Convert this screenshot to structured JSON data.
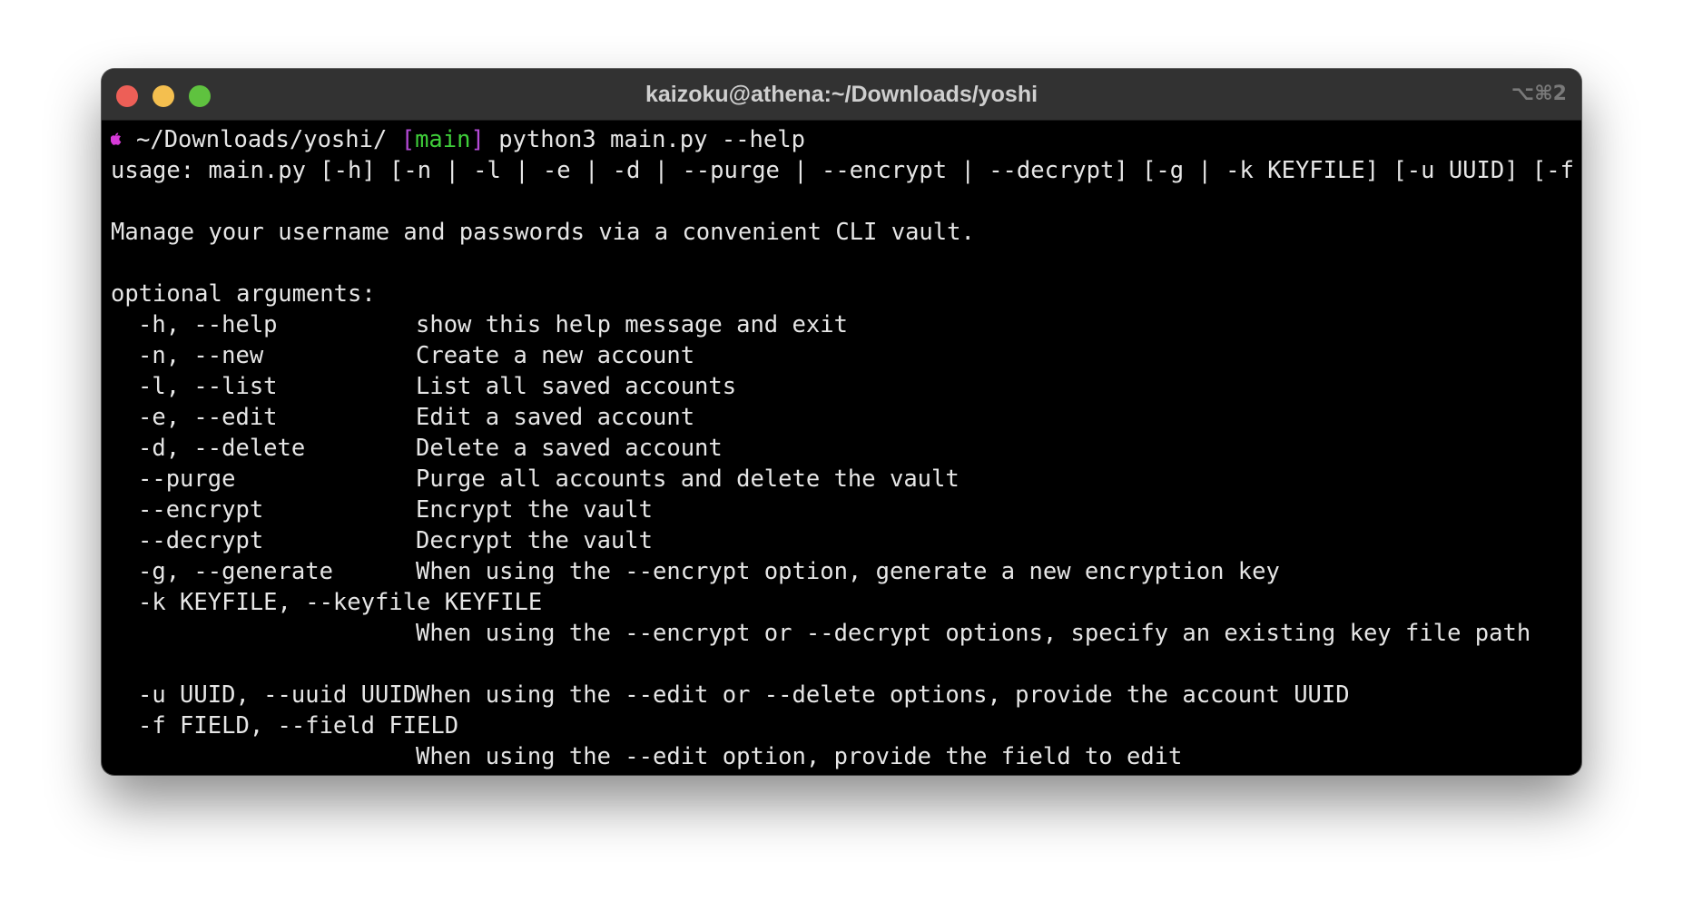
{
  "window": {
    "title": "kaizoku@athena:~/Downloads/yoshi",
    "shortcut": "⌥⌘2"
  },
  "prompt": {
    "path": "~/Downloads/yoshi/",
    "branch_open": "[",
    "branch": "main",
    "branch_close": "]",
    "command": "python3 main.py --help"
  },
  "output": {
    "usage": "usage: main.py [-h] [-n | -l | -e | -d | --purge | --encrypt | --decrypt] [-g | -k KEYFILE] [-u UUID] [-f FIELD]",
    "description": "Manage your username and passwords via a convenient CLI vault.",
    "section_header": "optional arguments:",
    "args": [
      {
        "flag": "-h, --help",
        "desc": "show this help message and exit"
      },
      {
        "flag": "-n, --new",
        "desc": "Create a new account"
      },
      {
        "flag": "-l, --list",
        "desc": "List all saved accounts"
      },
      {
        "flag": "-e, --edit",
        "desc": "Edit a saved account"
      },
      {
        "flag": "-d, --delete",
        "desc": "Delete a saved account"
      },
      {
        "flag": "--purge",
        "desc": "Purge all accounts and delete the vault"
      },
      {
        "flag": "--encrypt",
        "desc": "Encrypt the vault"
      },
      {
        "flag": "--decrypt",
        "desc": "Decrypt the vault"
      },
      {
        "flag": "-g, --generate",
        "desc": "When using the --encrypt option, generate a new encryption key"
      },
      {
        "flag": "-k KEYFILE, --keyfile KEYFILE",
        "desc": "When using the --encrypt or --decrypt options, specify an existing key file path"
      },
      {
        "flag": "-u UUID, --uuid UUID",
        "desc": "When using the --edit or --delete options, provide the account UUID"
      },
      {
        "flag": "-f FIELD, --field FIELD",
        "desc": "When using the --edit option, provide the field to edit"
      }
    ]
  },
  "colors": {
    "background": "#000000",
    "text": "#e6e6e6",
    "branch_bracket": "#b44ad6",
    "branch_name": "#3fcf3a",
    "apple_icon": "#d63ad8"
  }
}
